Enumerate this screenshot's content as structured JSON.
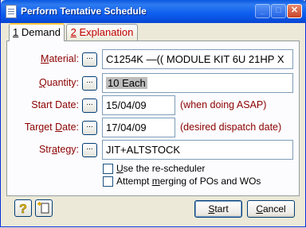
{
  "window": {
    "title": "Perform Tentative Schedule",
    "minimize": "_",
    "maximize": "□",
    "close": "✕"
  },
  "tabs": [
    {
      "num": "1",
      "label": " Demand"
    },
    {
      "num": "2",
      "label": " Explanation"
    }
  ],
  "form": {
    "material": {
      "label_pre": "",
      "label_u": "M",
      "label_post": "aterial:",
      "value": "C1254K    —(( MODULE KIT 6U 21HP X"
    },
    "quantity": {
      "label_pre": "",
      "label_u": "Q",
      "label_post": "uantity:",
      "value": "10 Each"
    },
    "start_date": {
      "label_pre": "Start Date",
      "label_u": "",
      "label_post": ":",
      "value": "15/04/09",
      "hint": "(when doing ASAP)"
    },
    "target_date": {
      "label_pre": "Target ",
      "label_u": "D",
      "label_post": "ate:",
      "value": "17/04/09",
      "hint": "(desired dispatch date)"
    },
    "strategy": {
      "label_pre": "Str",
      "label_u": "a",
      "label_post": "tegy:",
      "value": "JIT+ALTSTOCK"
    },
    "dots": "..."
  },
  "options": [
    {
      "pre": "",
      "u": "U",
      "post": "se the re-scheduler",
      "checked": false
    },
    {
      "pre": "Attempt ",
      "u": "m",
      "post": "erging of POs and WOs",
      "checked": false
    }
  ],
  "buttons": {
    "start": {
      "u": "S",
      "post": "tart"
    },
    "cancel": {
      "u": "C",
      "post": "ancel"
    },
    "help_icon": "question-help-icon",
    "new_icon": "new-document-icon"
  },
  "colors": {
    "label": "#8b0000",
    "title_bar": "#0a58e0",
    "active_tab_highlight": "#ffc83c"
  }
}
